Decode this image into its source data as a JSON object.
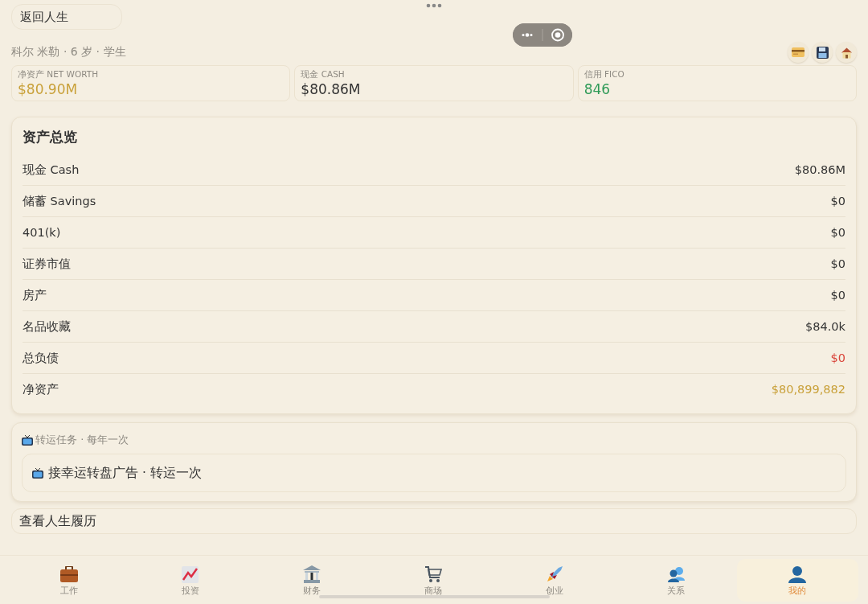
{
  "back_button": "返回人生",
  "profile": {
    "summary": "科尔 米勒 · 6 岁 · 学生",
    "actions": [
      {
        "kind": "card"
      },
      {
        "kind": "save"
      },
      {
        "kind": "home"
      }
    ]
  },
  "stats": [
    {
      "label": "净资产 NET WORTH",
      "value": "$80.90M",
      "color": "#c9a13a"
    },
    {
      "label": "现金 CASH",
      "value": "$80.86M",
      "color": "#333333"
    },
    {
      "label": "信用 FICO",
      "value": "846",
      "color": "#2e9a57"
    }
  ],
  "assets": {
    "title": "资产总览",
    "rows": [
      {
        "label": "现金 Cash",
        "value": "$80.86M",
        "color": "#333333"
      },
      {
        "label": "储蓄 Savings",
        "value": "$0",
        "color": "#333333"
      },
      {
        "label": "401(k)",
        "value": "$0",
        "color": "#333333"
      },
      {
        "label": "证券市值",
        "value": "$0",
        "color": "#333333"
      },
      {
        "label": "房产",
        "value": "$0",
        "color": "#333333"
      },
      {
        "label": "名品收藏",
        "value": "$84.0k",
        "color": "#333333"
      },
      {
        "label": "总负债",
        "value": "$0",
        "color": "#d9453b"
      },
      {
        "label": "净资产",
        "value": "$80,899,882",
        "color": "#c9a13a"
      }
    ]
  },
  "luck": {
    "title": "转运任务 · 每年一次",
    "action": "接幸运转盘广告 · 转运一次"
  },
  "history_button": "查看人生履历",
  "tabs": [
    {
      "label": "工作",
      "kind": "briefcase",
      "selected": false
    },
    {
      "label": "投资",
      "kind": "chart",
      "selected": false
    },
    {
      "label": "财务",
      "kind": "bank",
      "selected": false
    },
    {
      "label": "商场",
      "kind": "cart",
      "selected": false
    },
    {
      "label": "创业",
      "kind": "rocket",
      "selected": false
    },
    {
      "label": "关系",
      "kind": "people",
      "selected": false
    },
    {
      "label": "我的",
      "kind": "person",
      "selected": true
    }
  ]
}
